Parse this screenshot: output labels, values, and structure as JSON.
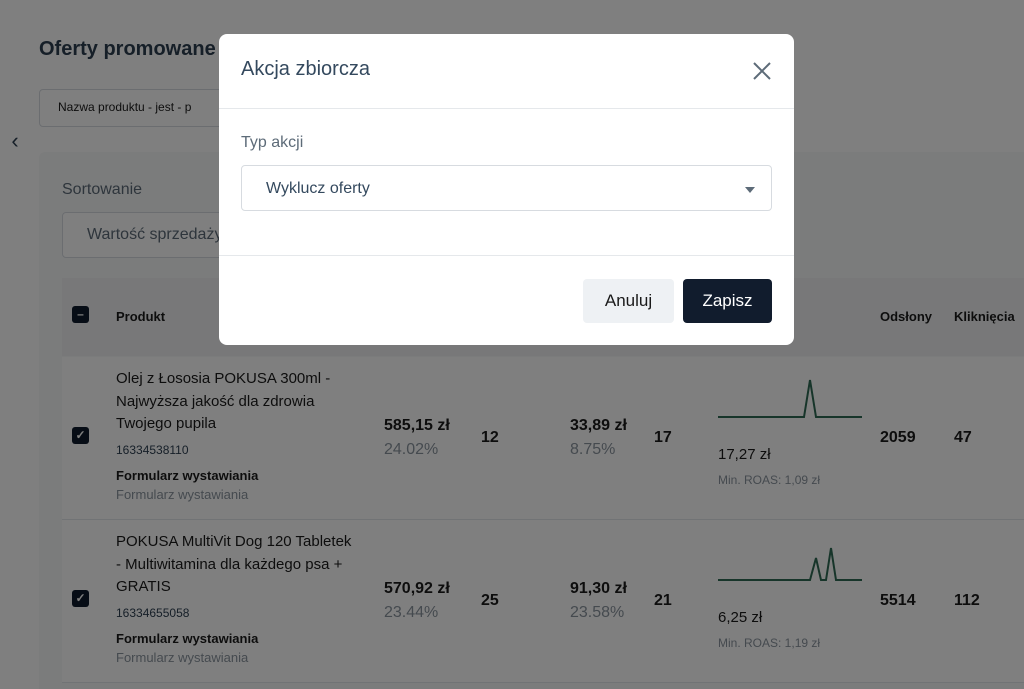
{
  "page": {
    "title": "Oferty promowane",
    "filter_chip": "Nazwa produktu - jest - p",
    "sort_label": "Sortowanie",
    "sort_value": "Wartość sprzedaży"
  },
  "table": {
    "headers": {
      "product": "Produkt",
      "impressions": "Odsłony",
      "clicks": "Kliknięcia"
    },
    "rows": [
      {
        "name": "Olej z Łososia POKUSA 300ml - Najwyższa jakość dla zdrowia Twojego pupila",
        "id": "16334538110",
        "form": "Formularz wystawiania",
        "form_sub": "Formularz wystawiania",
        "sales_value": "585,15 zł",
        "sales_pct": "24.02%",
        "sales_count": "12",
        "cost_value": "33,89 zł",
        "cost_pct": "8.75%",
        "cost_count": "17",
        "cpc": "17,27 zł",
        "min_roas": "Min. ROAS: 1,09 zł",
        "impressions": "2059",
        "clicks": "47",
        "checked": true
      },
      {
        "name": "POKUSA MultiVit Dog 120 Tabletek - Multiwitamina dla każdego psa + GRATIS",
        "id": "16334655058",
        "form": "Formularz wystawiania",
        "form_sub": "Formularz wystawiania",
        "sales_value": "570,92 zł",
        "sales_pct": "23.44%",
        "sales_count": "25",
        "cost_value": "91,30 zł",
        "cost_pct": "23.58%",
        "cost_count": "21",
        "cpc": "6,25 zł",
        "min_roas": "Min. ROAS: 1,19 zł",
        "impressions": "5514",
        "clicks": "112",
        "checked": true
      }
    ]
  },
  "modal": {
    "title": "Akcja zbiorcza",
    "field_label": "Typ akcji",
    "select_value": "Wyklucz oferty",
    "cancel_label": "Anuluj",
    "save_label": "Zapisz"
  },
  "colors": {
    "primary_dark": "#111c2d",
    "sparkline": "#2f6b55",
    "overlay": "rgba(0,0,0,0.5)"
  }
}
